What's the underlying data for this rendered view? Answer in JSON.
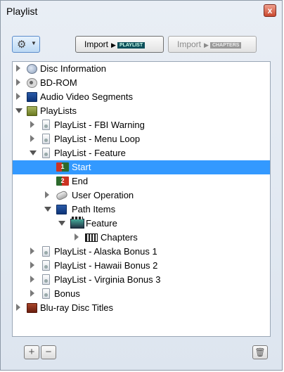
{
  "window": {
    "title": "Playlist",
    "close_label": "x"
  },
  "toolbar": {
    "gear_icon": "gear-icon",
    "import_playlist": {
      "label": "Import",
      "tag": "PLAYLIST"
    },
    "import_chapters": {
      "label": "Import",
      "tag": "CHAPTERS"
    }
  },
  "tree": {
    "items": [
      {
        "label": "Disc Information"
      },
      {
        "label": "BD-ROM"
      },
      {
        "label": "Audio Video Segments"
      },
      {
        "label": "PlayLists"
      },
      {
        "label": "PlayList - FBI Warning"
      },
      {
        "label": "PlayList - Menu Loop"
      },
      {
        "label": "PlayList - Feature"
      },
      {
        "label": "Start",
        "badge": "1"
      },
      {
        "label": "End",
        "badge": "2"
      },
      {
        "label": "User Operation"
      },
      {
        "label": "Path Items"
      },
      {
        "label": "Feature"
      },
      {
        "label": "Chapters"
      },
      {
        "label": "PlayList - Alaska Bonus 1"
      },
      {
        "label": "PlayList - Hawaii Bonus 2"
      },
      {
        "label": "PlayList - Virginia Bonus 3"
      },
      {
        "label": "Bonus"
      },
      {
        "label": "Blu-ray Disc Titles"
      }
    ],
    "selected": "Start"
  },
  "bottom": {
    "add": "+",
    "remove": "−",
    "trash_icon": "trash-icon"
  },
  "colors": {
    "selection": "#3399ff",
    "window_bg": "#dde5ef"
  }
}
